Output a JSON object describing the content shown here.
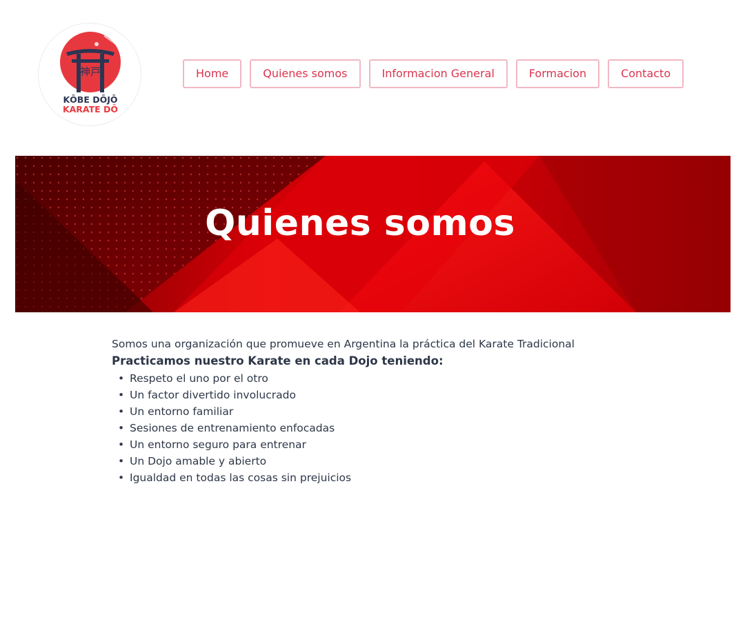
{
  "logo": {
    "kanji": "神戸",
    "line1": "KŌBE DŌJŌ",
    "line2": "KARATE DŌ",
    "colors": {
      "red": "#e8383f",
      "navy": "#2b3553"
    }
  },
  "nav": {
    "items": [
      {
        "label": "Home"
      },
      {
        "label": "Quienes somos"
      },
      {
        "label": "Informacion General"
      },
      {
        "label": "Formacion"
      },
      {
        "label": "Contacto"
      }
    ]
  },
  "hero": {
    "title": "Quienes somos",
    "colors": {
      "base": "#c20008",
      "bright": "#f00a0f",
      "dark": "#5a0000"
    }
  },
  "content": {
    "intro": "Somos una organización que promueve en Argentina la práctica del Karate Tradicional",
    "subheading": "Practicamos nuestro Karate en cada Dojo teniendo:",
    "items": [
      "Respeto el uno por el otro",
      "Un factor divertido involucrado",
      "Un entorno familiar",
      "Sesiones de entrenamiento enfocadas",
      "Un entorno seguro para entrenar",
      "Un Dojo amable y abierto",
      "Igualdad en todas las cosas sin prejuicios"
    ]
  }
}
